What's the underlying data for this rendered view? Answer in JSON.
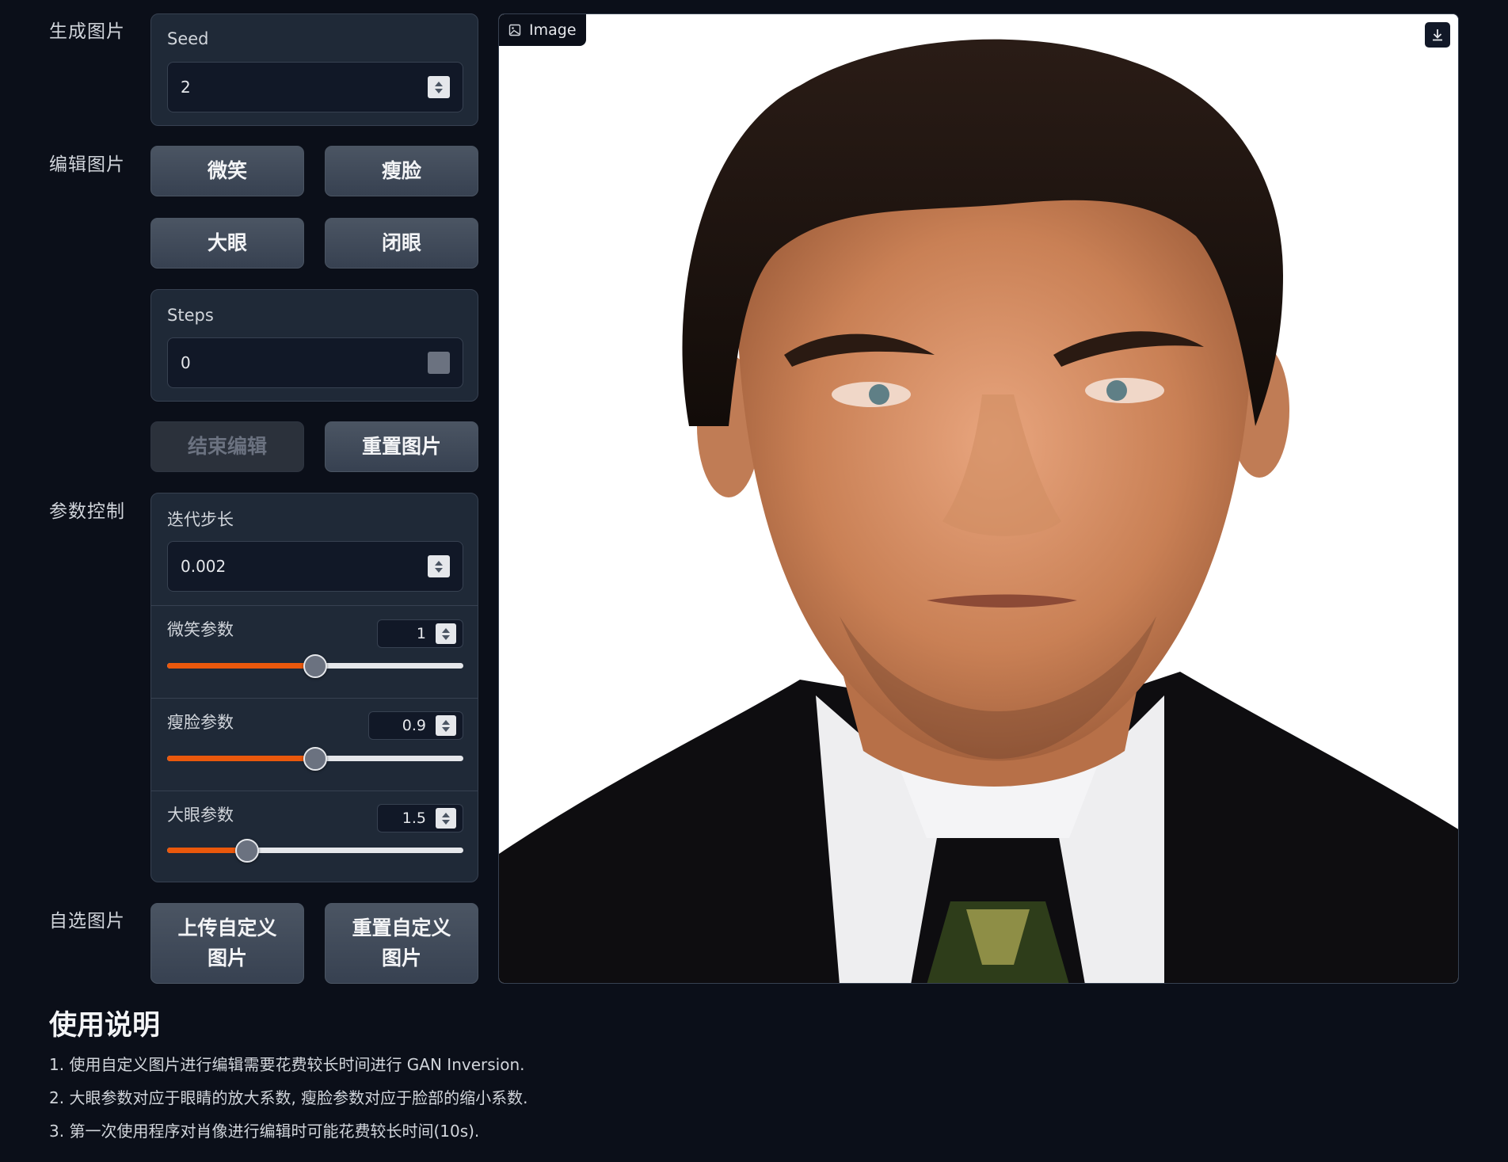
{
  "sections": {
    "generate": "生成图片",
    "edit": "编辑图片",
    "params": "参数控制",
    "custom": "自选图片"
  },
  "seed": {
    "label": "Seed",
    "value": "2"
  },
  "edit_buttons": {
    "smile": "微笑",
    "slim": "瘦脸",
    "big_eye": "大眼",
    "close_eye": "闭眼"
  },
  "steps": {
    "label": "Steps",
    "value": "0"
  },
  "actions": {
    "end_edit": "结束编辑",
    "reset_image": "重置图片"
  },
  "step_size": {
    "label": "迭代步长",
    "value": "0.002"
  },
  "sliders": [
    {
      "label": "微笑参数",
      "value": "1",
      "fraction": 0.5
    },
    {
      "label": "瘦脸参数",
      "value": "0.9",
      "fraction": 0.5
    },
    {
      "label": "大眼参数",
      "value": "1.5",
      "fraction": 0.27
    }
  ],
  "custom_buttons": {
    "upload_line1": "上传自定义",
    "upload_line2": "图片",
    "reset_line1": "重置自定义",
    "reset_line2": "图片"
  },
  "image": {
    "label": "Image"
  },
  "usage": {
    "title": "使用说明",
    "lines": [
      "1. 使用自定义图片进行编辑需要花费较长时间进行 GAN Inversion.",
      "2. 大眼参数对应于眼睛的放大系数, 瘦脸参数对应于脸部的缩小系数.",
      "3. 第一次使用程序对肖像进行编辑时可能花费较长时间(10s)."
    ]
  },
  "colors": {
    "accent": "#ea580c",
    "background": "#0b0f19",
    "panel": "#1f2937"
  },
  "icons": {
    "image_label": "image-icon",
    "download": "download-icon"
  }
}
